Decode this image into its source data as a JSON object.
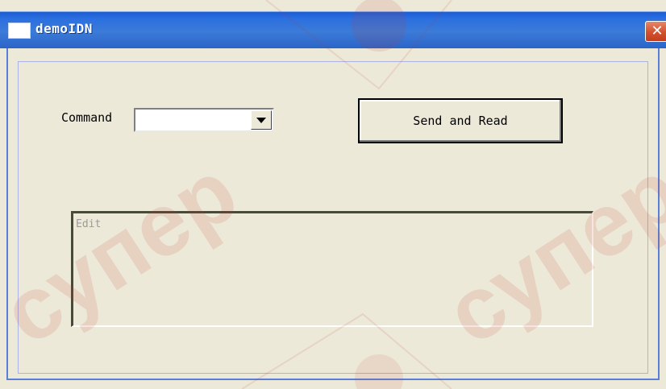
{
  "window": {
    "title": "demoIDN",
    "close_glyph": "✕",
    "icon": "window-app-icon"
  },
  "form": {
    "command_label": "Command",
    "command_value": "",
    "send_button_label": "Send and Read",
    "edit_label": "Edit"
  },
  "watermark": {
    "text_left": "супер",
    "text_right": "супер"
  },
  "colors": {
    "titlebar": "#2b6fe0",
    "face": "#ece9d8",
    "close": "#d2512e",
    "watermark": "#c83a2e"
  }
}
